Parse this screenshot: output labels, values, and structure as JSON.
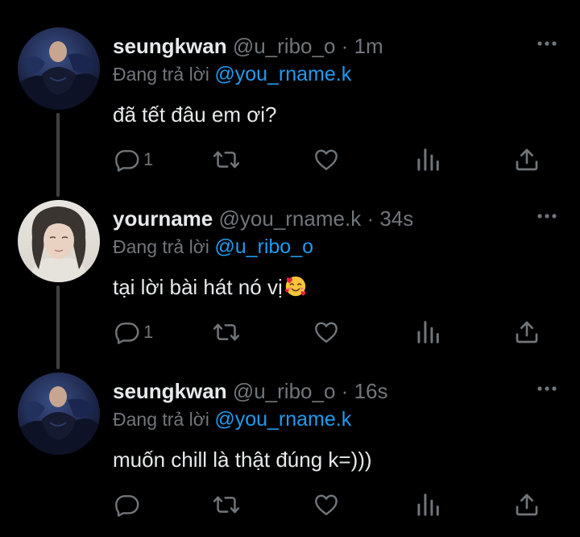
{
  "tweets": [
    {
      "display_name": "seungkwan",
      "handle": "@u_ribo_o",
      "separator": "·",
      "time": "1m",
      "replying_prefix": "Đang trả lời",
      "replying_to": "@you_rname.k",
      "text": "đã tết đâu em ơi?",
      "reply_count": "1",
      "avatar": "dark-portrait"
    },
    {
      "display_name": "yourname",
      "handle": "@you_rname.k",
      "separator": "·",
      "time": "34s",
      "replying_prefix": "Đang trả lời",
      "replying_to": "@u_ribo_o",
      "text": "tại lời bài hát nó vị",
      "emoji": "smiling-face-with-hearts",
      "reply_count": "1",
      "avatar": "light-portrait"
    },
    {
      "display_name": "seungkwan",
      "handle": "@u_ribo_o",
      "separator": "·",
      "time": "16s",
      "replying_prefix": "Đang trả lời",
      "replying_to": "@you_rname.k",
      "text": "muốn chill là thật đúng k=)))",
      "reply_count": "",
      "avatar": "dark-portrait"
    }
  ],
  "icons": [
    "reply-icon",
    "retweet-icon",
    "like-icon",
    "analytics-icon",
    "share-icon",
    "more-icon"
  ],
  "colors": {
    "background": "#000000",
    "primary_text": "#e7e9ea",
    "secondary_text": "#71767b",
    "accent": "#1d9bf0",
    "thread_line": "#3e4144"
  }
}
